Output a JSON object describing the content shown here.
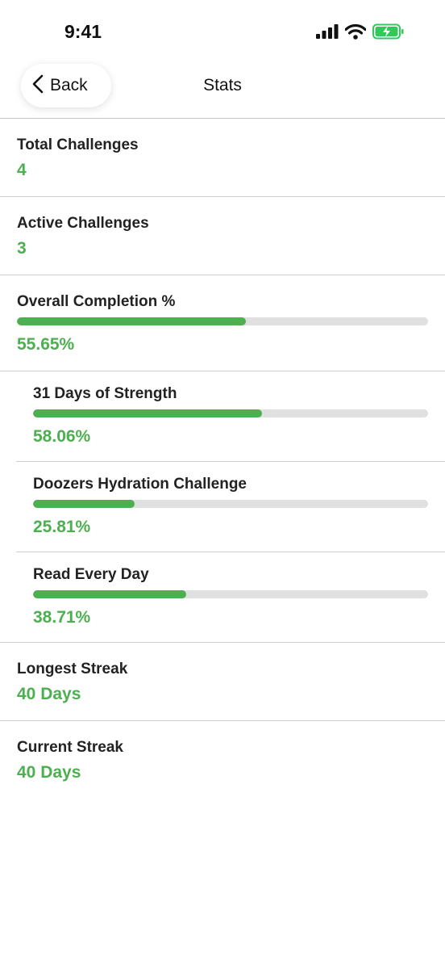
{
  "status_bar": {
    "time": "9:41",
    "icons": [
      "signal-icon",
      "wifi-icon",
      "battery-charging-icon"
    ],
    "battery_color": "#34c759"
  },
  "nav": {
    "back_label": "Back",
    "title": "Stats"
  },
  "stats": {
    "total_label": "Total Challenges",
    "total_value": "4",
    "active_label": "Active Challenges",
    "active_value": "3",
    "overall_label": "Overall Completion %",
    "overall_value": "55.65%",
    "overall_fraction": 0.5565,
    "challenges": [
      {
        "name": "31 Days of Strength",
        "value": "58.06%",
        "fraction": 0.5806
      },
      {
        "name": "Doozers Hydration Challenge",
        "value": "25.81%",
        "fraction": 0.2581
      },
      {
        "name": "Read Every Day",
        "value": "38.71%",
        "fraction": 0.3871
      }
    ],
    "longest_label": "Longest Streak",
    "longest_value": "40 Days",
    "current_label": "Current Streak",
    "current_value": "40 Days"
  },
  "colors": {
    "accent": "#4caf50",
    "track": "#e0e0e0",
    "divider": "#d0d0d0"
  }
}
